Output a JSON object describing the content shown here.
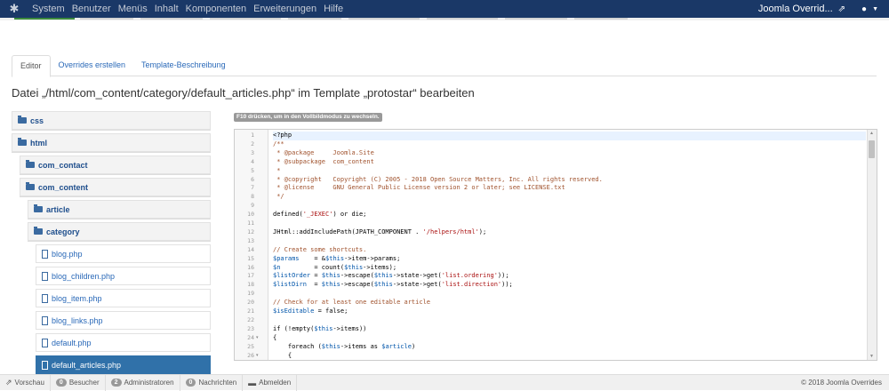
{
  "navbar": {
    "logo_icon": "joomla-icon",
    "menu": [
      "System",
      "Benutzer",
      "Menüs",
      "Inhalt",
      "Komponenten",
      "Erweiterungen",
      "Hilfe"
    ],
    "site_name": "Joomla Overrid...",
    "site_link_icon": "external-link-icon",
    "user_icon": "user-icon"
  },
  "tabs": [
    "Editor",
    "Overrides erstellen",
    "Template-Beschreibung"
  ],
  "page_title": "Datei „/html/com_content/category/default_articles.php“ im Template „protostar“ bearbeiten",
  "tree": {
    "items": [
      {
        "label": "css",
        "type": "folder",
        "indent": 0
      },
      {
        "label": "html",
        "type": "folder",
        "indent": 0
      },
      {
        "label": "com_contact",
        "type": "folder",
        "indent": 1
      },
      {
        "label": "com_content",
        "type": "folder",
        "indent": 1
      },
      {
        "label": "article",
        "type": "folder",
        "indent": 2
      },
      {
        "label": "category",
        "type": "folder",
        "indent": 2
      },
      {
        "label": "blog.php",
        "type": "file",
        "indent": 3
      },
      {
        "label": "blog_children.php",
        "type": "file",
        "indent": 3
      },
      {
        "label": "blog_item.php",
        "type": "file",
        "indent": 3
      },
      {
        "label": "blog_links.php",
        "type": "file",
        "indent": 3
      },
      {
        "label": "default.php",
        "type": "file",
        "indent": 3
      },
      {
        "label": "default_articles.php",
        "type": "file",
        "indent": 3,
        "selected": true
      }
    ]
  },
  "editor": {
    "hint": "F10 drücken, um in den Vollbildmodus zu wechseln.",
    "lines": [
      {
        "n": "1",
        "segs": [
          [
            "<?php",
            "#000"
          ]
        ]
      },
      {
        "n": "2",
        "segs": [
          [
            "/**",
            "#a0522d"
          ]
        ]
      },
      {
        "n": "3",
        "segs": [
          [
            " * @package     Joomla.Site",
            "#a0522d"
          ]
        ]
      },
      {
        "n": "4",
        "segs": [
          [
            " * @subpackage  com_content",
            "#a0522d"
          ]
        ]
      },
      {
        "n": "5",
        "segs": [
          [
            " *",
            "#a0522d"
          ]
        ]
      },
      {
        "n": "6",
        "segs": [
          [
            " * @copyright   Copyright (C) 2005 - 2018 Open Source Matters, Inc. All rights reserved.",
            "#a0522d"
          ]
        ]
      },
      {
        "n": "7",
        "segs": [
          [
            " * @license     GNU General Public License version 2 or later; see LICENSE.txt",
            "#a0522d"
          ]
        ]
      },
      {
        "n": "8",
        "segs": [
          [
            " */",
            "#a0522d"
          ]
        ]
      },
      {
        "n": "9",
        "segs": [
          [
            "",
            "#000"
          ]
        ]
      },
      {
        "n": "10",
        "segs": [
          [
            "defined(",
            "#000"
          ],
          [
            "'_JEXEC'",
            "#a11"
          ],
          [
            ") or die;",
            "#000"
          ]
        ]
      },
      {
        "n": "11",
        "segs": [
          [
            "",
            "#000"
          ]
        ]
      },
      {
        "n": "12",
        "segs": [
          [
            "JHtml::addIncludePath(JPATH_COMPONENT . ",
            "#000"
          ],
          [
            "'/helpers/html'",
            "#a11"
          ],
          [
            ");",
            "#000"
          ]
        ]
      },
      {
        "n": "13",
        "segs": [
          [
            "",
            "#000"
          ]
        ]
      },
      {
        "n": "14",
        "segs": [
          [
            "// Create some shortcuts.",
            "#a0522d"
          ]
        ]
      },
      {
        "n": "15",
        "segs": [
          [
            "$params",
            "#05a"
          ],
          [
            "    = &",
            "#000"
          ],
          [
            "$this",
            "#05a"
          ],
          [
            "->item->params;",
            "#000"
          ]
        ]
      },
      {
        "n": "16",
        "segs": [
          [
            "$n",
            "#05a"
          ],
          [
            "         = count(",
            "#000"
          ],
          [
            "$this",
            "#05a"
          ],
          [
            "->items);",
            "#000"
          ]
        ]
      },
      {
        "n": "17",
        "segs": [
          [
            "$listOrder",
            "#05a"
          ],
          [
            " = ",
            "#000"
          ],
          [
            "$this",
            "#05a"
          ],
          [
            "->escape(",
            "#000"
          ],
          [
            "$this",
            "#05a"
          ],
          [
            "->state->get(",
            "#000"
          ],
          [
            "'list.ordering'",
            "#a11"
          ],
          [
            "));",
            "#000"
          ]
        ]
      },
      {
        "n": "18",
        "segs": [
          [
            "$listDirn",
            "#05a"
          ],
          [
            "  = ",
            "#000"
          ],
          [
            "$this",
            "#05a"
          ],
          [
            "->escape(",
            "#000"
          ],
          [
            "$this",
            "#05a"
          ],
          [
            "->state->get(",
            "#000"
          ],
          [
            "'list.direction'",
            "#a11"
          ],
          [
            "));",
            "#000"
          ]
        ]
      },
      {
        "n": "19",
        "segs": [
          [
            "",
            "#000"
          ]
        ]
      },
      {
        "n": "20",
        "segs": [
          [
            "// Check for at least one editable article",
            "#a0522d"
          ]
        ]
      },
      {
        "n": "21",
        "segs": [
          [
            "$isEditable",
            "#05a"
          ],
          [
            " = false;",
            "#000"
          ]
        ]
      },
      {
        "n": "22",
        "segs": [
          [
            "",
            "#000"
          ]
        ]
      },
      {
        "n": "23",
        "segs": [
          [
            "if (!empty(",
            "#000"
          ],
          [
            "$this",
            "#05a"
          ],
          [
            "->items))",
            "#000"
          ]
        ]
      },
      {
        "n": "24",
        "fold": true,
        "segs": [
          [
            "{",
            "#000"
          ]
        ]
      },
      {
        "n": "25",
        "segs": [
          [
            "    foreach (",
            "#000"
          ],
          [
            "$this",
            "#05a"
          ],
          [
            "->items as ",
            "#000"
          ],
          [
            "$article",
            "#05a"
          ],
          [
            ")",
            "#000"
          ]
        ]
      },
      {
        "n": "26",
        "fold": true,
        "segs": [
          [
            "    {",
            "#000"
          ]
        ]
      }
    ]
  },
  "statusbar": {
    "preview": "Vorschau",
    "visitors_count": "0",
    "visitors_label": "Besucher",
    "admins_count": "2",
    "admins_label": "Administratoren",
    "messages_count": "0",
    "messages_label": "Nachrichten",
    "logout": "Abmelden",
    "copyright": "© 2018 Joomla Overrides"
  }
}
